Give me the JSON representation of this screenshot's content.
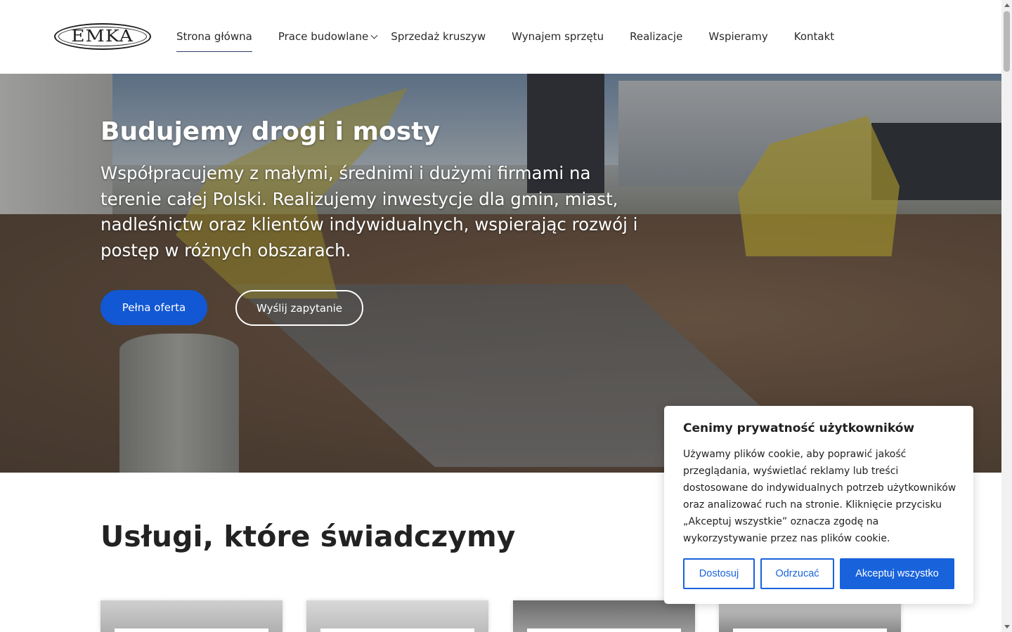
{
  "header": {
    "logo_text": "EMKA",
    "nav": [
      {
        "label": "Strona główna"
      },
      {
        "label": "Prace budowlane"
      },
      {
        "label": "Sprzedaż kruszyw"
      },
      {
        "label": "Wynajem sprzętu"
      },
      {
        "label": "Realizacje"
      },
      {
        "label": "Wspieramy"
      },
      {
        "label": "Kontakt"
      }
    ]
  },
  "hero": {
    "title": "Budujemy drogi i mosty",
    "description": "Współpracujemy z małymi, średnimi i dużymi firmami na terenie całej Polski. Realizujemy inwestycje dla gmin, miast, nadleśnictw oraz klientów indywidualnych, wspierając rozwój i postęp w różnych obszarach.",
    "primary_button": "Pełna oferta",
    "secondary_button": "Wyślij zapytanie"
  },
  "services": {
    "title_bold": "Usługi",
    "title_rest": ", które świadczymy"
  },
  "cookie": {
    "title": "Cenimy prywatność użytkowników",
    "text": "Używamy plików cookie, aby poprawić jakość przeglądania, wyświetlać reklamy lub treści dostosowane do indywidualnych potrzeb użytkowników oraz analizować ruch na stronie. Kliknięcie przycisku „Akceptuj wszystkie” oznacza zgodę na wykorzystywanie przez nas plików cookie.",
    "customize": "Dostosuj",
    "reject": "Odrzucać",
    "accept": "Akceptuj wszystko"
  },
  "colors": {
    "brand_blue": "#1257d3",
    "cookie_blue": "#1863dc"
  }
}
